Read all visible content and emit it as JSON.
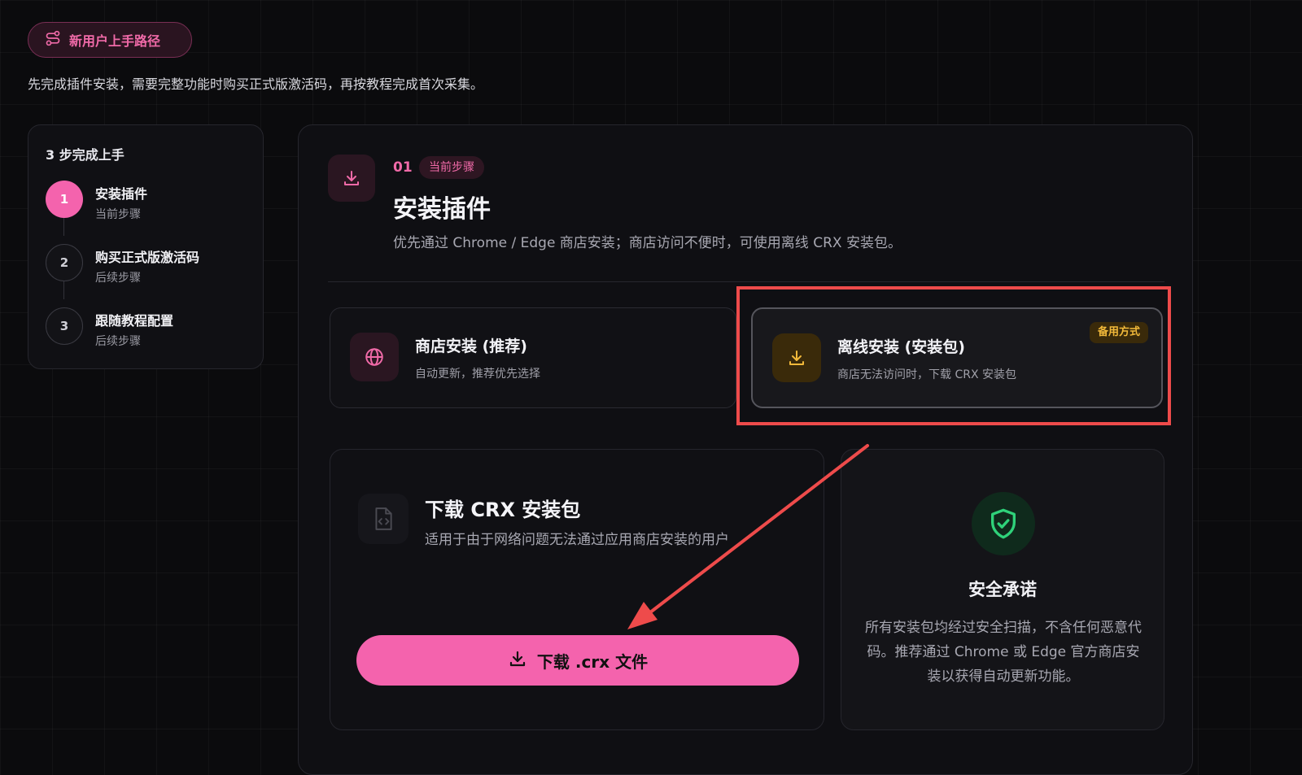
{
  "header": {
    "pill_label": "新用户上手路径",
    "intro": "先完成插件安装，需要完整功能时购买正式版激活码，再按教程完成首次采集。"
  },
  "steps": {
    "title": "3 步完成上手",
    "items": [
      {
        "num": "1",
        "title": "安装插件",
        "status": "当前步骤"
      },
      {
        "num": "2",
        "title": "购买正式版激活码",
        "status": "后续步骤"
      },
      {
        "num": "3",
        "title": "跟随教程配置",
        "status": "后续步骤"
      }
    ]
  },
  "main": {
    "step_number": "01",
    "current_badge": "当前步骤",
    "title": "安装插件",
    "description": "优先通过 Chrome / Edge 商店安装；商店访问不便时，可使用离线 CRX 安装包。",
    "options": [
      {
        "title": "商店安装 (推荐)",
        "desc": "自动更新，推荐优先选择",
        "icon": "globe-icon"
      },
      {
        "title": "离线安装 (安装包)",
        "desc": "商店无法访问时，下载 CRX 安装包",
        "icon": "download-icon",
        "badge": "备用方式"
      }
    ],
    "download": {
      "title": "下载 CRX 安装包",
      "desc": "适用于由于网络问题无法通过应用商店安装的用户",
      "button_label": "下载 .crx 文件"
    },
    "security": {
      "title": "安全承诺",
      "text": "所有安装包均经过安全扫描，不含任何恶意代码。推荐通过 Chrome 或 Edge 官方商店安装以获得自动更新功能。"
    }
  },
  "colors": {
    "accent": "#f463ad",
    "warning": "#f2b93a",
    "success": "#2fd27a",
    "annotation": "#ee4b4b"
  }
}
